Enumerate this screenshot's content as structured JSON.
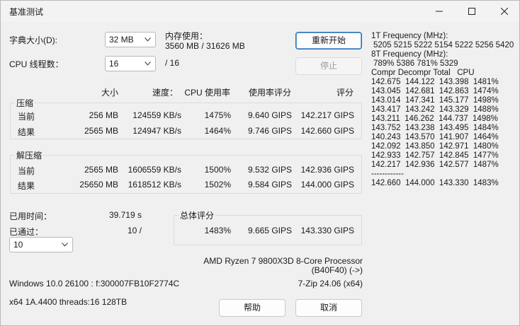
{
  "window": {
    "title": "基准测试"
  },
  "dict": {
    "label": "字典大小(D):",
    "value": "32 MB"
  },
  "memory": {
    "label": "内存使用：",
    "value": "3560 MB / 31626 MB"
  },
  "threads": {
    "label": "CPU 线程数：",
    "value": "16",
    "total": "/ 16"
  },
  "buttons": {
    "restart": "重新开始",
    "stop": "停止",
    "help": "帮助",
    "cancel": "取消"
  },
  "table_headers": {
    "size": "大小",
    "speed": "速度：",
    "cpu_usage": "CPU 使用率",
    "usage_rating": "使用率评分",
    "rating": "评分"
  },
  "compress": {
    "title": "压缩",
    "rows": [
      {
        "label": "当前",
        "size": "256 MB",
        "speed": "124559 KB/s",
        "usage": "1475%",
        "urating": "9.640 GIPS",
        "rating": "142.217 GIPS"
      },
      {
        "label": "结果",
        "size": "2565 MB",
        "speed": "124947 KB/s",
        "usage": "1464%",
        "urating": "9.746 GIPS",
        "rating": "142.660 GIPS"
      }
    ]
  },
  "decompress": {
    "title": "解压缩",
    "rows": [
      {
        "label": "当前",
        "size": "2565 MB",
        "speed": "1606559 KB/s",
        "usage": "1500%",
        "urating": "9.532 GIPS",
        "rating": "142.936 GIPS"
      },
      {
        "label": "结果",
        "size": "25650 MB",
        "speed": "1618512 KB/s",
        "usage": "1502%",
        "urating": "9.584 GIPS",
        "rating": "144.000 GIPS"
      }
    ]
  },
  "elapsed": {
    "label": "已用时间：",
    "value": "39.719 s"
  },
  "passed": {
    "label": "已通过：",
    "value": "10 /",
    "combo": "10"
  },
  "total": {
    "title": "总体评分",
    "usage": "1483%",
    "urating": "9.665 GIPS",
    "rating": "143.330 GIPS"
  },
  "cpu": {
    "name": "AMD Ryzen 7 9800X3D 8-Core Processor",
    "id": "(B40F40) (->)"
  },
  "os": "Windows 10.0 26100 : f:300007FB10F2774C",
  "zip_version": "7-Zip 24.06 (x64)",
  "arch": "x64 1A.4400 threads:16 128TB",
  "log": {
    "freq1_label": "1T Frequency (MHz):",
    "freq1": "5205 5215 5222 5154 5222 5256 5420",
    "freq8_label": "8T Frequency (MHz):",
    "freq8": "789% 5386 781% 5329",
    "header": "Compr Decompr Total   CPU",
    "rows": [
      "142.675  144.122  143.398  1481%",
      "143.045  142.681  142.863  1474%",
      "143.014  147.341  145.177  1498%",
      "143.417  143.242  143.329  1488%",
      "143.211  146.262  144.737  1498%",
      "143.752  143.238  143.495  1484%",
      "140.243  143.570  141.907  1464%",
      "142.092  143.850  142.971  1480%",
      "142.933  142.757  142.845  1477%",
      "142.217  142.936  142.577  1487%"
    ],
    "separator": "------------",
    "summary": "142.660  144.000  143.330  1483%"
  }
}
